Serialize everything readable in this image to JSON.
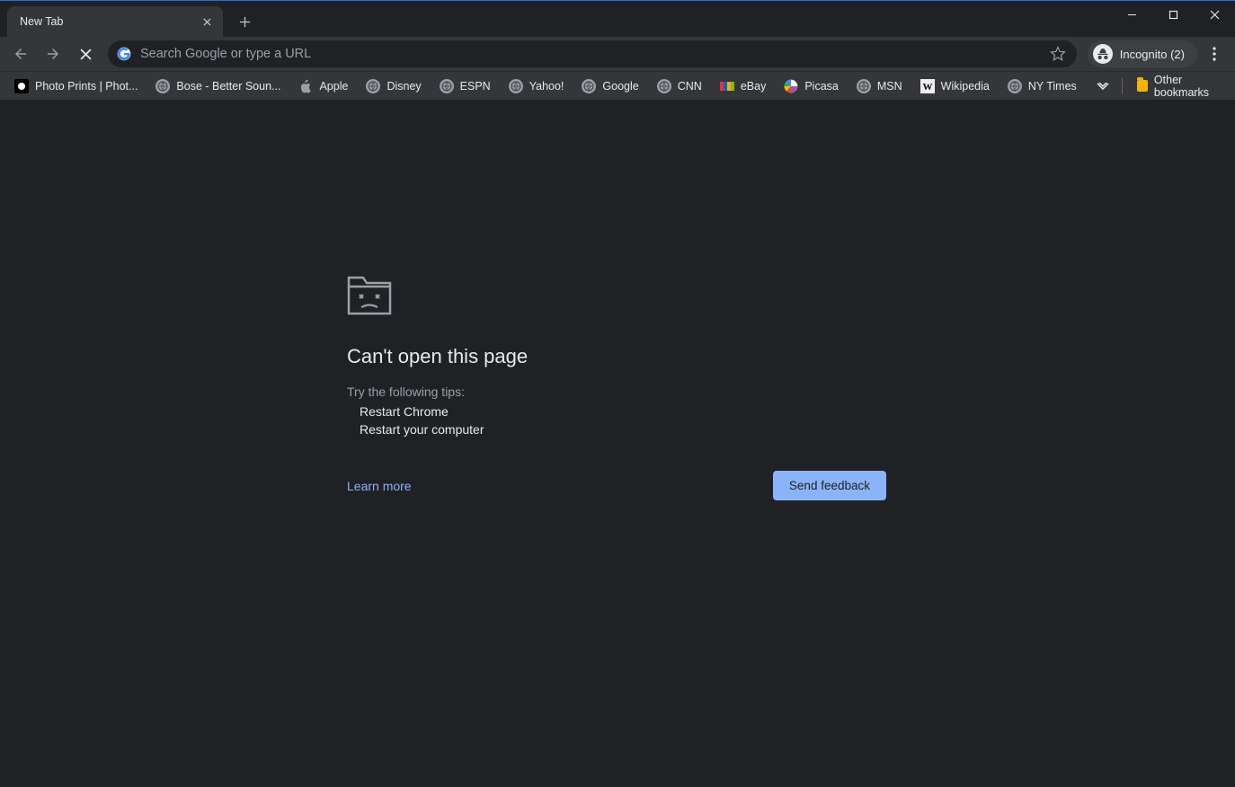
{
  "tab": {
    "title": "New Tab"
  },
  "omnibox": {
    "placeholder": "Search Google or type a URL"
  },
  "incognito": {
    "label": "Incognito (2)"
  },
  "bookmarks": {
    "items": [
      {
        "label": "Photo Prints | Phot...",
        "icon": "photo"
      },
      {
        "label": "Bose - Better Soun...",
        "icon": "globe"
      },
      {
        "label": "Apple",
        "icon": "apple"
      },
      {
        "label": "Disney",
        "icon": "globe"
      },
      {
        "label": "ESPN",
        "icon": "globe"
      },
      {
        "label": "Yahoo!",
        "icon": "globe"
      },
      {
        "label": "Google",
        "icon": "globe"
      },
      {
        "label": "CNN",
        "icon": "globe"
      },
      {
        "label": "eBay",
        "icon": "ebay"
      },
      {
        "label": "Picasa",
        "icon": "picasa"
      },
      {
        "label": "MSN",
        "icon": "globe"
      },
      {
        "label": "Wikipedia",
        "icon": "wiki"
      },
      {
        "label": "NY Times",
        "icon": "globe"
      }
    ],
    "other": "Other bookmarks"
  },
  "error": {
    "title": "Can't open this page",
    "subtitle": "Try the following tips:",
    "tips": [
      "Restart Chrome",
      "Restart your computer"
    ],
    "learn_more": "Learn more",
    "feedback": "Send feedback"
  }
}
